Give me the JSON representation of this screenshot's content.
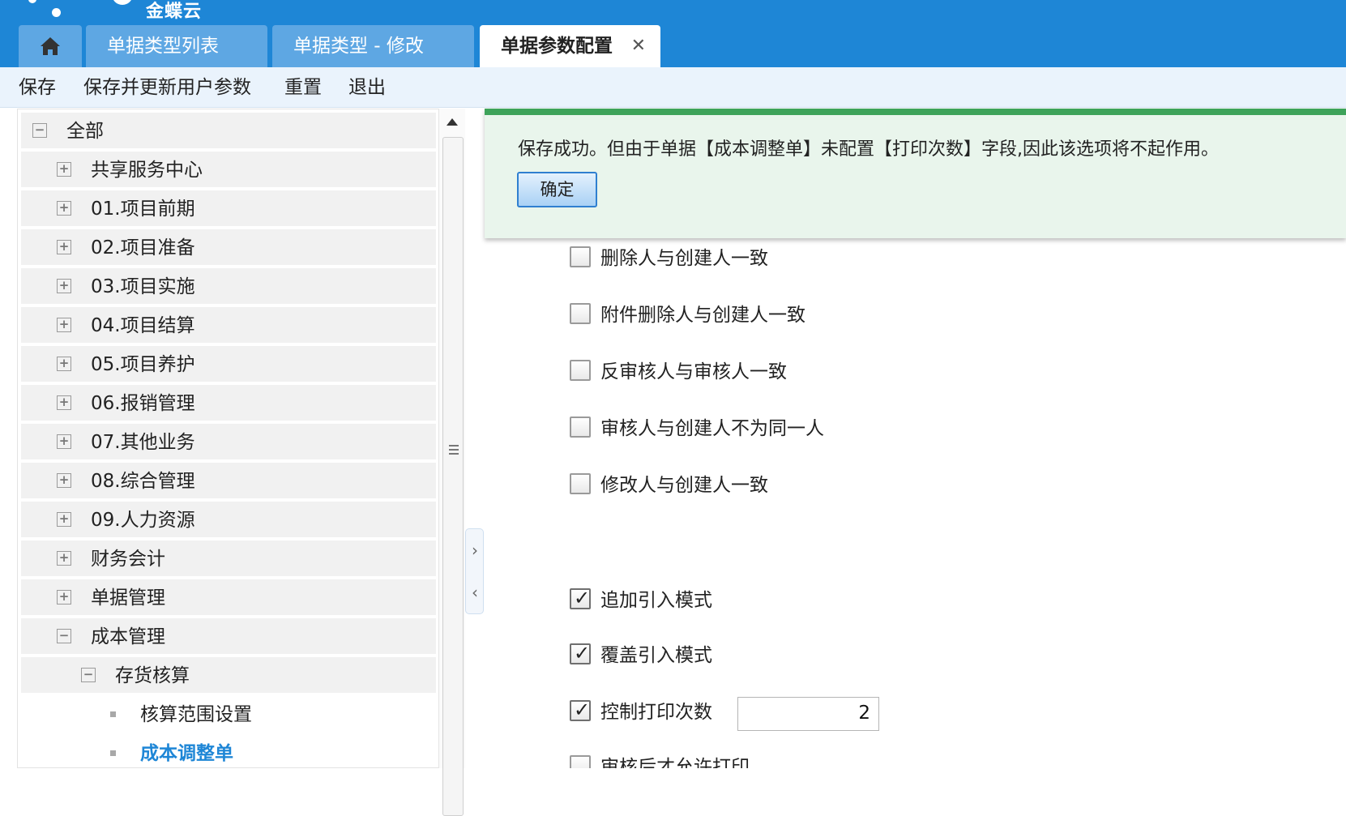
{
  "brand": {
    "name": "金蝶云"
  },
  "tabs": [
    {
      "label": "单据类型列表"
    },
    {
      "label": "单据类型 - 修改"
    },
    {
      "label": "单据参数配置",
      "close": "✕"
    }
  ],
  "toolbar": {
    "save": "保存",
    "save_update": "保存并更新用户参数",
    "reset": "重置",
    "exit": "退出"
  },
  "tree": {
    "root": {
      "label": "全部",
      "toggle": "−"
    },
    "items": [
      {
        "label": "共享服务中心",
        "toggle": "+"
      },
      {
        "label": "01.项目前期",
        "toggle": "+"
      },
      {
        "label": "02.项目准备",
        "toggle": "+"
      },
      {
        "label": "03.项目实施",
        "toggle": "+"
      },
      {
        "label": "04.项目结算",
        "toggle": "+"
      },
      {
        "label": "05.项目养护",
        "toggle": "+"
      },
      {
        "label": "06.报销管理",
        "toggle": "+"
      },
      {
        "label": "07.其他业务",
        "toggle": "+"
      },
      {
        "label": "08.综合管理",
        "toggle": "+"
      },
      {
        "label": "09.人力资源",
        "toggle": "+"
      },
      {
        "label": "财务会计",
        "toggle": "+"
      },
      {
        "label": "单据管理",
        "toggle": "+"
      },
      {
        "label": "成本管理",
        "toggle": "−"
      }
    ],
    "sub": {
      "label": "存货核算",
      "toggle": "−"
    },
    "leaves": [
      {
        "label": "核算范围设置",
        "selected": false
      },
      {
        "label": "成本调整单",
        "selected": true
      }
    ]
  },
  "notice": {
    "message": "保存成功。但由于单据【成本调整单】未配置【打印次数】字段,因此该选项将不起作用。",
    "confirm": "确定",
    "color": "#3ea35a"
  },
  "options": [
    {
      "label": "删除人与创建人一致",
      "checked": false
    },
    {
      "label": "附件删除人与创建人一致",
      "checked": false
    },
    {
      "label": "反审核人与审核人一致",
      "checked": false
    },
    {
      "label": "审核人与创建人不为同一人",
      "checked": false
    },
    {
      "label": "修改人与创建人一致",
      "checked": false
    },
    {
      "label": "追加引入模式",
      "checked": true
    },
    {
      "label": "覆盖引入模式",
      "checked": true
    },
    {
      "label": "控制打印次数",
      "checked": true
    },
    {
      "label": "审核后才允许打印",
      "checked": false
    }
  ],
  "print_count": {
    "value": "2"
  },
  "check_mark": "✓",
  "colors": {
    "topbar": "#1e86d6",
    "tab": "#5ea7e3",
    "selected": "#1e86d6"
  }
}
